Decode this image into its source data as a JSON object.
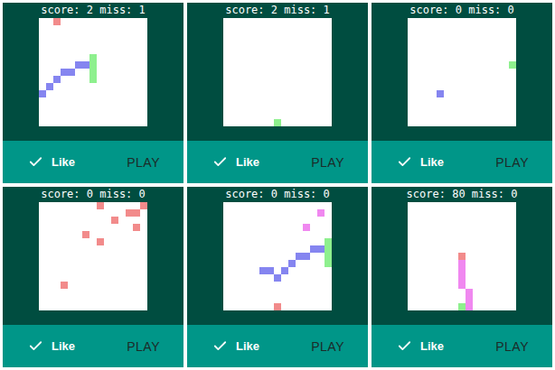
{
  "cards": [
    {
      "header": "score: 2 miss: 1",
      "like": "Like",
      "liked": true,
      "play": "PLAY",
      "cells": [
        {
          "col": 2,
          "row": 0,
          "color": "#f28b8b"
        },
        {
          "col": 0,
          "row": 10,
          "color": "#8585f0"
        },
        {
          "col": 1,
          "row": 9,
          "color": "#8585f0"
        },
        {
          "col": 2,
          "row": 8,
          "color": "#8585f0"
        },
        {
          "col": 3,
          "row": 7,
          "color": "#8585f0"
        },
        {
          "col": 4,
          "row": 7,
          "color": "#8585f0"
        },
        {
          "col": 5,
          "row": 6,
          "color": "#8585f0"
        },
        {
          "col": 6,
          "row": 6,
          "color": "#8585f0"
        },
        {
          "col": 7,
          "row": 5,
          "color": "#8ef08e"
        },
        {
          "col": 7,
          "row": 6,
          "color": "#8ef08e"
        },
        {
          "col": 7,
          "row": 7,
          "color": "#8ef08e"
        },
        {
          "col": 7,
          "row": 8,
          "color": "#8ef08e"
        }
      ]
    },
    {
      "header": "score: 2 miss: 1",
      "like": "Like",
      "liked": true,
      "play": "PLAY",
      "cells": [
        {
          "col": 7,
          "row": 14,
          "color": "#8ef08e"
        }
      ]
    },
    {
      "header": "score: 0 miss: 0",
      "like": "Like",
      "liked": true,
      "play": "PLAY",
      "cells": [
        {
          "col": 4,
          "row": 10,
          "color": "#8585f0"
        },
        {
          "col": 14,
          "row": 6,
          "color": "#8ef08e"
        }
      ]
    },
    {
      "header": "score: 0 miss: 0",
      "like": "Like",
      "liked": true,
      "play": "PLAY",
      "cells": [
        {
          "col": 8,
          "row": 0,
          "color": "#f28b8b"
        },
        {
          "col": 14,
          "row": 0,
          "color": "#f28b8b"
        },
        {
          "col": 12,
          "row": 1,
          "color": "#f28b8b"
        },
        {
          "col": 13,
          "row": 1,
          "color": "#f28b8b"
        },
        {
          "col": 10,
          "row": 2,
          "color": "#f28b8b"
        },
        {
          "col": 13,
          "row": 3,
          "color": "#f28b8b"
        },
        {
          "col": 6,
          "row": 4,
          "color": "#f28b8b"
        },
        {
          "col": 8,
          "row": 5,
          "color": "#f28b8b"
        },
        {
          "col": 3,
          "row": 11,
          "color": "#f28b8b"
        }
      ]
    },
    {
      "header": "score: 0 miss: 0",
      "like": "Like",
      "liked": true,
      "play": "PLAY",
      "cells": [
        {
          "col": 13,
          "row": 1,
          "color": "#f088f0"
        },
        {
          "col": 11,
          "row": 3,
          "color": "#f088f0"
        },
        {
          "col": 5,
          "row": 9,
          "color": "#8585f0"
        },
        {
          "col": 6,
          "row": 9,
          "color": "#8585f0"
        },
        {
          "col": 7,
          "row": 10,
          "color": "#8585f0"
        },
        {
          "col": 8,
          "row": 9,
          "color": "#8585f0"
        },
        {
          "col": 9,
          "row": 8,
          "color": "#8585f0"
        },
        {
          "col": 10,
          "row": 7,
          "color": "#8585f0"
        },
        {
          "col": 11,
          "row": 7,
          "color": "#8585f0"
        },
        {
          "col": 12,
          "row": 6,
          "color": "#8585f0"
        },
        {
          "col": 13,
          "row": 6,
          "color": "#8585f0"
        },
        {
          "col": 14,
          "row": 5,
          "color": "#8ef08e"
        },
        {
          "col": 14,
          "row": 6,
          "color": "#8ef08e"
        },
        {
          "col": 14,
          "row": 7,
          "color": "#8ef08e"
        },
        {
          "col": 14,
          "row": 8,
          "color": "#8ef08e"
        },
        {
          "col": 7,
          "row": 14,
          "color": "#f28b8b"
        }
      ]
    },
    {
      "header": "score: 80 miss: 0",
      "like": "Like",
      "liked": true,
      "play": "PLAY",
      "cells": [
        {
          "col": 7,
          "row": 7,
          "color": "#f28b8b"
        },
        {
          "col": 7,
          "row": 8,
          "color": "#f088f0"
        },
        {
          "col": 7,
          "row": 9,
          "color": "#f088f0"
        },
        {
          "col": 7,
          "row": 10,
          "color": "#f088f0"
        },
        {
          "col": 7,
          "row": 11,
          "color": "#f088f0"
        },
        {
          "col": 8,
          "row": 12,
          "color": "#f088f0"
        },
        {
          "col": 8,
          "row": 13,
          "color": "#f088f0"
        },
        {
          "col": 8,
          "row": 14,
          "color": "#f088f0"
        },
        {
          "col": 7,
          "row": 14,
          "color": "#8ef08e"
        }
      ]
    }
  ]
}
